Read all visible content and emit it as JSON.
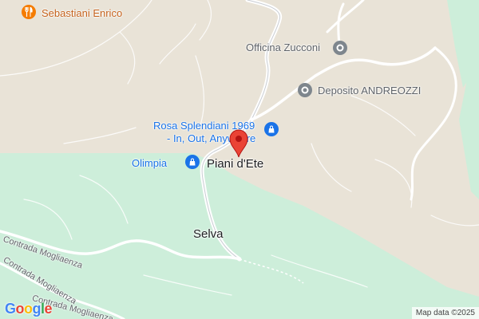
{
  "colors": {
    "land": "#e9e3d7",
    "forest": "#cdeeda",
    "road": "#ffffff",
    "poi_blue": "#1a73e8",
    "poi_gray": "#5f6368",
    "poi_orange": "#c5621c",
    "pin": "#ea4335"
  },
  "pois": {
    "restaurant": {
      "name": "Sebastiani Enrico",
      "icon": "fork-knife-icon"
    },
    "officina": {
      "name": "Officina Zucconi",
      "icon": "place-icon"
    },
    "deposito": {
      "name": "Deposito ANDREOZZI",
      "icon": "place-icon"
    },
    "rosa": {
      "line1": "Rosa Splendiani 1969",
      "line2": "- In, Out, Anywhere",
      "icon": "shopping-bag-icon"
    },
    "olimpia": {
      "name": "Olimpia",
      "icon": "shopping-bag-icon"
    }
  },
  "places": {
    "piani": "Piani d'Ete",
    "selva": "Selva"
  },
  "roads": {
    "contrada1": "Contrada Mogliaenza",
    "contrada2": "Contrada Mogliaenza",
    "contrada3": "Contrada Mogliaenza"
  },
  "pin": {
    "icon": "location-pin-icon"
  },
  "branding": {
    "logo_letters": [
      "G",
      "o",
      "o",
      "g",
      "l",
      "e"
    ],
    "logo_colors": [
      "#4285f4",
      "#ea4335",
      "#fbbc05",
      "#4285f4",
      "#34a853",
      "#ea4335"
    ],
    "attribution": "Map data ©2025"
  }
}
